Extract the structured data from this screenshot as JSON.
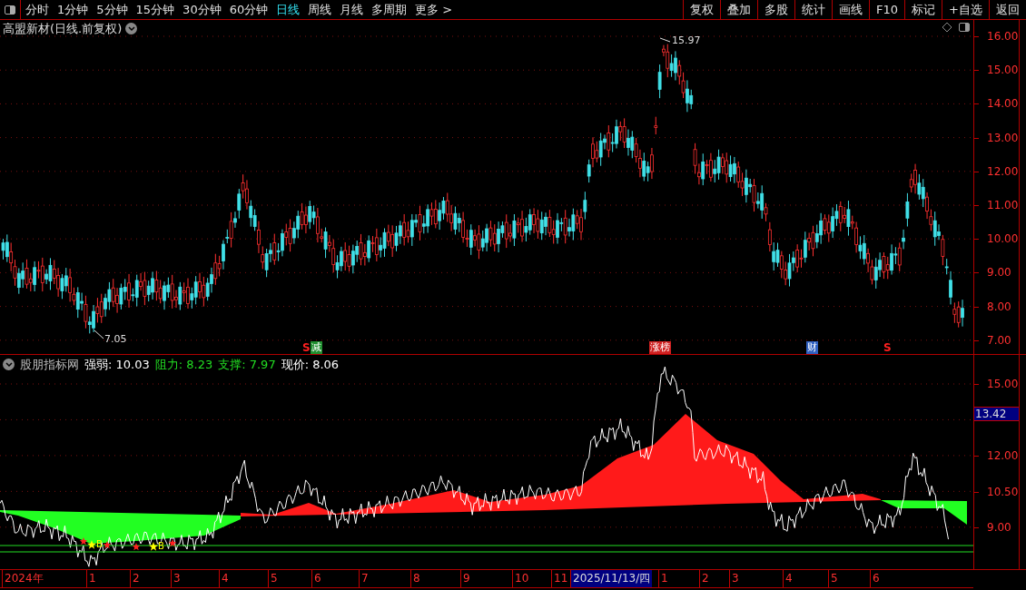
{
  "toolbar": {
    "periods": [
      {
        "label": "分时",
        "selected": false
      },
      {
        "label": "1分钟",
        "selected": false
      },
      {
        "label": "5分钟",
        "selected": false
      },
      {
        "label": "15分钟",
        "selected": false
      },
      {
        "label": "30分钟",
        "selected": false
      },
      {
        "label": "60分钟",
        "selected": false
      },
      {
        "label": "日线",
        "selected": true
      },
      {
        "label": "周线",
        "selected": false
      },
      {
        "label": "月线",
        "selected": false
      },
      {
        "label": "多周期",
        "selected": false
      },
      {
        "label": "更多 >",
        "selected": false
      }
    ],
    "buttons": [
      "复权",
      "叠加",
      "多股",
      "统计",
      "画线",
      "F10",
      "标记",
      "+自选",
      "返回"
    ]
  },
  "price_chart": {
    "title": "高盟新材(日线.前复权)",
    "high_label": "15.97",
    "low_label": "7.05",
    "axis_labels": [
      "16.00",
      "15.00",
      "14.00",
      "13.00",
      "12.00",
      "11.00",
      "10.00",
      "9.00",
      "8.00",
      "7.00"
    ],
    "markers": [
      {
        "text": "S",
        "kind": "letter",
        "color": "#ff2020"
      },
      {
        "text": "减",
        "kind": "tag",
        "color": "#1f8f2f"
      },
      {
        "text": "涨榜",
        "kind": "tag",
        "color": "#d02020"
      },
      {
        "text": "财",
        "kind": "tag",
        "color": "#3060c0"
      },
      {
        "text": "S",
        "kind": "letter",
        "color": "#ff2020"
      }
    ]
  },
  "indicator": {
    "name": "股朋指标网",
    "values": [
      {
        "label": "强弱: 10.03",
        "color": "#ffffff"
      },
      {
        "label": "阻力: 8.23",
        "color": "#22dd22"
      },
      {
        "label": "支撑: 7.97",
        "color": "#22dd22"
      },
      {
        "label": "现价: 8.06",
        "color": "#ffffff"
      }
    ],
    "axis_labels": [
      "15.00",
      "12.00",
      "10.50",
      "9.00"
    ],
    "current_value": "13.42",
    "signals": [
      "B",
      "B"
    ]
  },
  "time_axis": [
    {
      "label": "2024年",
      "selected": false
    },
    {
      "label": "1",
      "selected": false
    },
    {
      "label": "2",
      "selected": false
    },
    {
      "label": "3",
      "selected": false
    },
    {
      "label": "4",
      "selected": false
    },
    {
      "label": "5",
      "selected": false
    },
    {
      "label": "6",
      "selected": false
    },
    {
      "label": "7",
      "selected": false
    },
    {
      "label": "8",
      "selected": false
    },
    {
      "label": "9",
      "selected": false
    },
    {
      "label": "10",
      "selected": false
    },
    {
      "label": "11",
      "selected": false
    },
    {
      "label": "2025/11/13/四",
      "selected": true
    },
    {
      "label": "1",
      "selected": false
    },
    {
      "label": "2",
      "selected": false
    },
    {
      "label": "3",
      "selected": false
    },
    {
      "label": "4",
      "selected": false
    },
    {
      "label": "5",
      "selected": false
    },
    {
      "label": "6",
      "selected": false
    }
  ]
}
